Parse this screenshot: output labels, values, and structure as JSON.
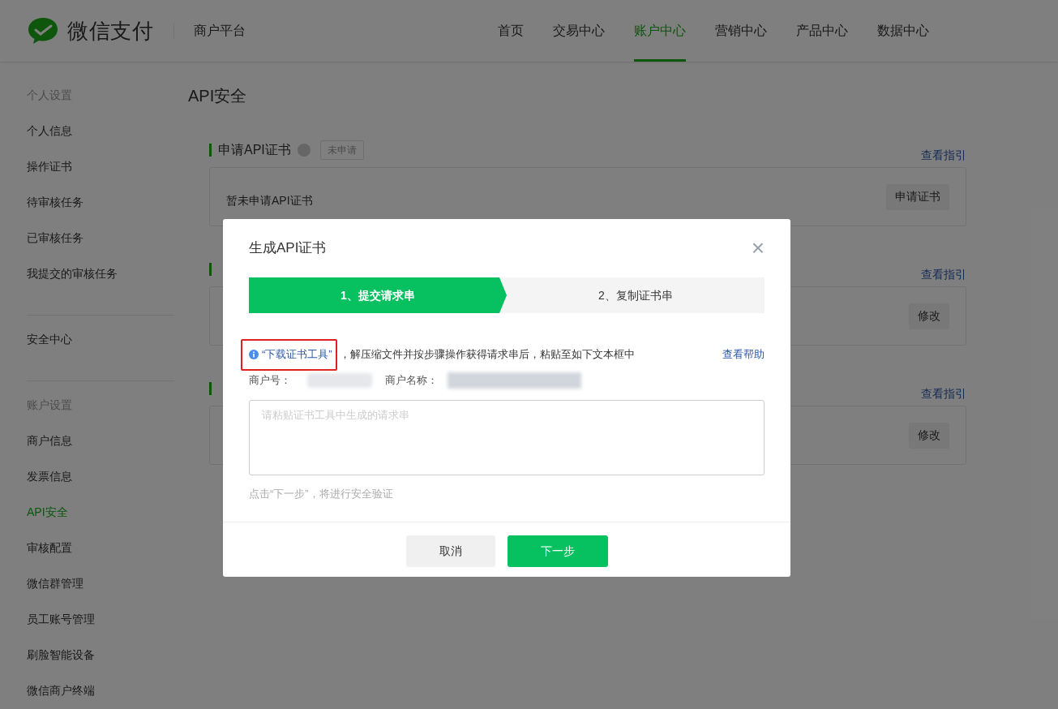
{
  "header": {
    "logo_text": "微信支付",
    "platform": "商户平台",
    "nav": [
      {
        "label": "首页",
        "selected": false
      },
      {
        "label": "交易中心",
        "selected": false
      },
      {
        "label": "账户中心",
        "selected": true
      },
      {
        "label": "营销中心",
        "selected": false
      },
      {
        "label": "产品中心",
        "selected": false
      },
      {
        "label": "数据中心",
        "selected": false
      }
    ]
  },
  "sidebar": {
    "groups": [
      {
        "heading": "个人设置",
        "items": [
          {
            "label": "个人信息",
            "selected": false
          },
          {
            "label": "操作证书",
            "selected": false
          },
          {
            "label": "待审核任务",
            "selected": false
          },
          {
            "label": "已审核任务",
            "selected": false
          },
          {
            "label": "我提交的审核任务",
            "selected": false
          }
        ]
      },
      {
        "items": [
          {
            "label": "安全中心",
            "selected": false
          }
        ]
      },
      {
        "heading": "账户设置",
        "items": [
          {
            "label": "商户信息",
            "selected": false
          },
          {
            "label": "发票信息",
            "selected": false
          },
          {
            "label": "API安全",
            "selected": true
          },
          {
            "label": "审核配置",
            "selected": false
          },
          {
            "label": "微信群管理",
            "selected": false
          },
          {
            "label": "员工账号管理",
            "selected": false
          },
          {
            "label": "刷脸智能设备",
            "selected": false
          },
          {
            "label": "微信商户终端",
            "selected": false
          }
        ]
      }
    ]
  },
  "page_title": "API安全",
  "sections": [
    {
      "title": "申请API证书",
      "help": true,
      "badge": "未申请",
      "link": "查看指引",
      "card_text": "暂未申请API证书",
      "button": "申请证书"
    },
    {
      "help": false,
      "link": "查看指引",
      "button": "修改"
    },
    {
      "help": false,
      "link": "查看指引",
      "button": "修改"
    }
  ],
  "dialog": {
    "title": "生成API证书",
    "close": "×",
    "steps": [
      {
        "label": "1、提交请求串",
        "selected": true
      },
      {
        "label": "2、复制证书串",
        "selected": false
      }
    ],
    "download_link": "“下载证书工具”",
    "instruction": "，解压缩文件并按步骤操作获得请求串后，粘贴至如下文本框中",
    "help_link": "查看帮助",
    "merchant_id_label": "商户号：",
    "merchant_name_label": "商户名称：",
    "textarea": {
      "placeholder": "请粘贴证书工具中生成的请求串"
    },
    "note": "点击“下一步”，将进行安全验证",
    "buttons": [
      {
        "label": "取消",
        "kind": "secondary"
      },
      {
        "label": "下一步",
        "kind": "primary"
      }
    ]
  }
}
